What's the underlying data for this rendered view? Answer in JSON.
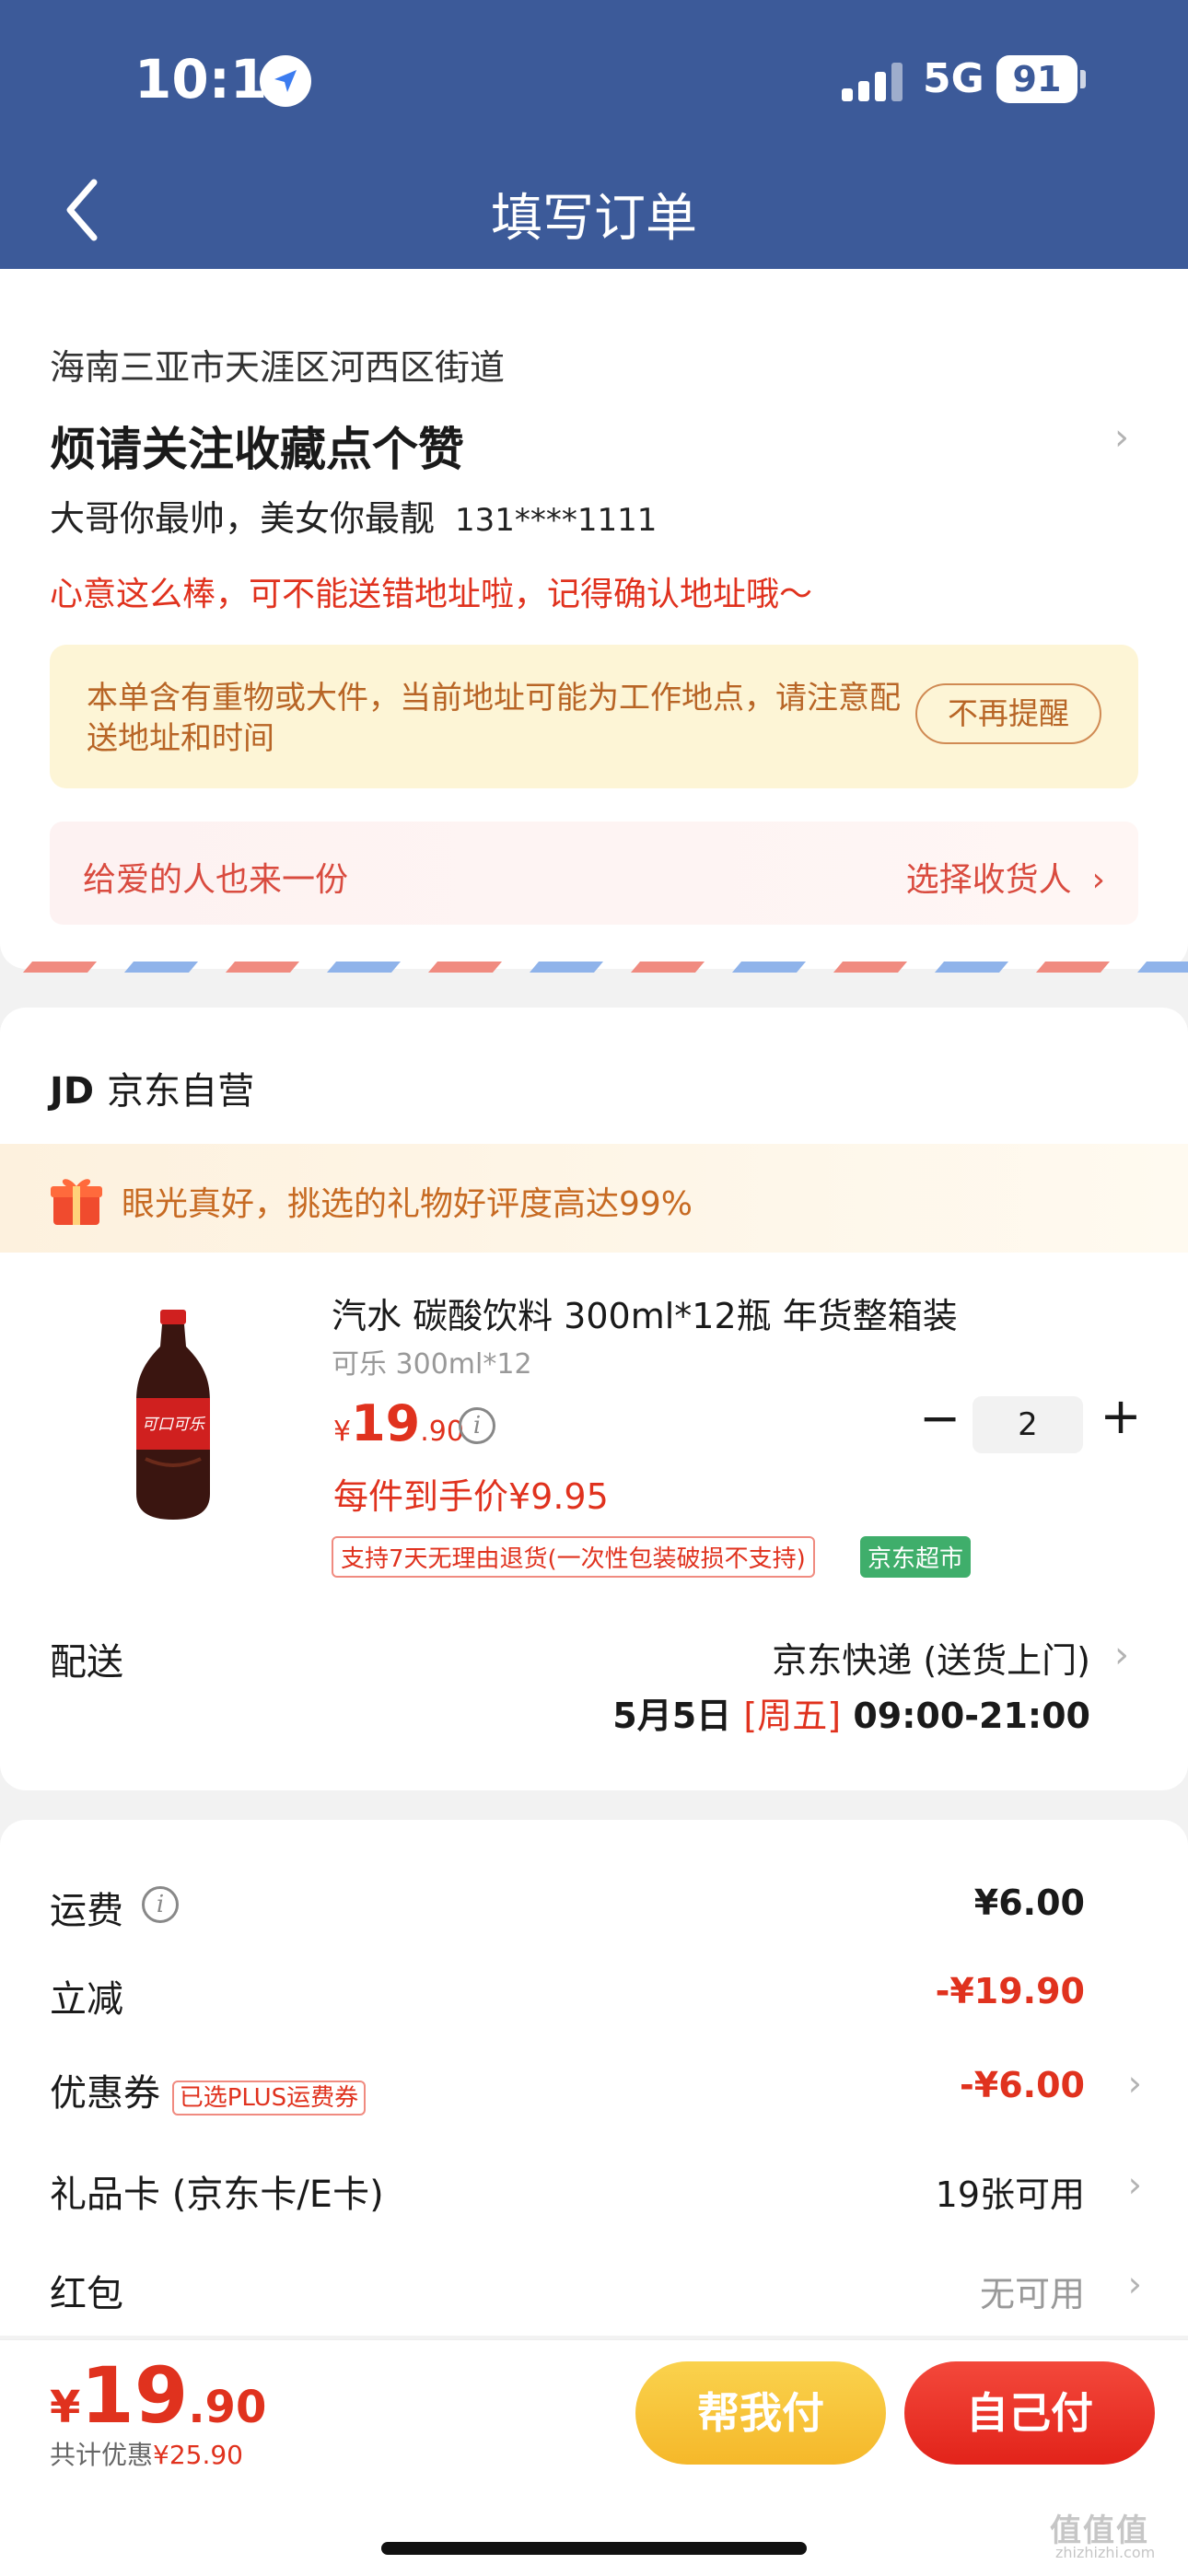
{
  "status_bar": {
    "time": "10:11",
    "network": "5G",
    "battery": "91"
  },
  "nav": {
    "title": "填写订单"
  },
  "address": {
    "region": "海南三亚市天涯区河西区街道",
    "title": "烦请关注收藏点个赞",
    "name": "大哥你最帅，美女你最靓",
    "phone": "131****1111",
    "warning": "心意这么棒，可不能送错地址啦，记得确认地址哦～",
    "notice": "本单含有重物或大件，当前地址可能为工作地点，请注意配送地址和时间",
    "notice_button": "不再提醒",
    "gift_row_label": "给爱的人也来一份",
    "gift_row_action": "选择收货人"
  },
  "store": {
    "logo": "JD",
    "name": "京东自营"
  },
  "promo": {
    "text": "眼光真好，挑选的礼物好评度高达99%"
  },
  "product": {
    "name": "汽水 碳酸饮料 300ml*12瓶 年货整箱装",
    "spec": "可乐 300ml*12",
    "price_currency": "¥",
    "price_int": "19",
    "price_dec": ".90",
    "unit_price": "每件到手价¥9.95",
    "return_tag": "支持7天无理由退货(一次性包装破损不支持)",
    "channel_tag": "京东超市",
    "quantity": "2",
    "qty_minus": "−",
    "qty_plus": "+",
    "bottle_label": "可口可乐"
  },
  "shipping": {
    "label": "配送",
    "method": "京东快递 (送货上门)",
    "date": "5月5日",
    "weekday": "[周五]",
    "time": "09:00-21:00"
  },
  "fees": {
    "freight_label": "运费",
    "freight_value": "¥6.00",
    "discount_label": "立减",
    "discount_value": "-¥19.90",
    "coupon_label": "优惠券",
    "coupon_tag": "已选PLUS运费券",
    "coupon_value": "-¥6.00",
    "giftcard_label": "礼品卡 (京东卡/E卡)",
    "giftcard_value": "19张可用",
    "redpacket_label": "红包",
    "redpacket_value": "无可用"
  },
  "bottom": {
    "currency": "¥",
    "total_int": "19",
    "total_dec": ".90",
    "saved_label": "共计优惠",
    "saved_value": "¥25.90",
    "help_pay": "帮我付",
    "self_pay": "自己付"
  },
  "watermark": {
    "main": "值值值",
    "sub": "zhizhizhi.com"
  },
  "colors": {
    "header": "#3c5a99",
    "accent_red": "#e0321e",
    "notice_bg": "#fdf5d6",
    "jd_green": "#3fae6b"
  },
  "icons": {
    "location": "location-arrow-icon",
    "back": "chevron-left-icon",
    "info": "info-circle-icon",
    "gift": "gift-box-icon",
    "chevron": "chevron-right-icon"
  }
}
